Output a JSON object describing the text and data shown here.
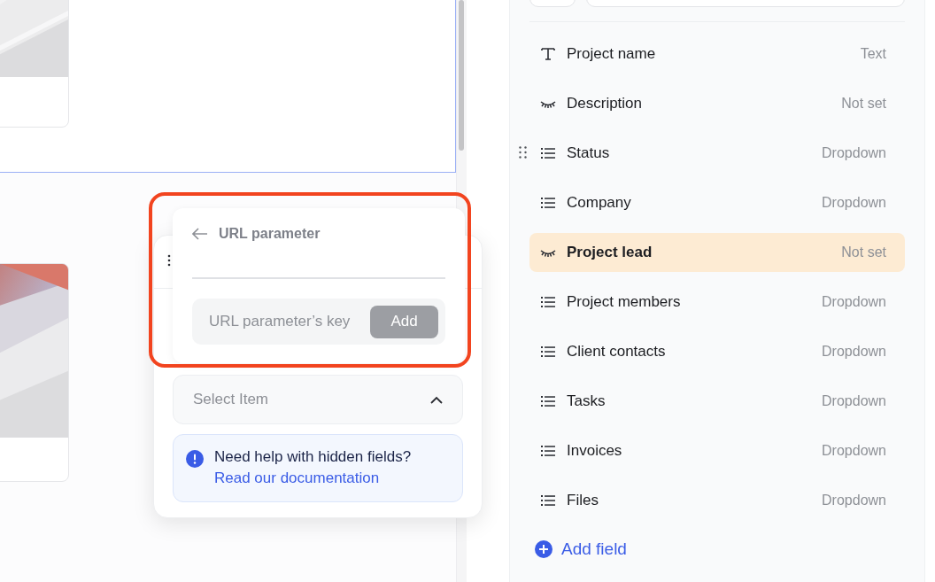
{
  "url_parameter": {
    "title": "URL parameter",
    "key_field": {
      "placeholder": "URL parameter’s key"
    },
    "add_button": {
      "label": "Add",
      "disabled": true
    }
  },
  "popover": {
    "select": {
      "placeholder": "Select Item",
      "expanded": true
    },
    "help": {
      "text": "Need help with hidden fields?",
      "link": "Read our documentation"
    }
  },
  "fields_panel": {
    "fields": [
      {
        "label": "Project name",
        "type": "Text",
        "kind": "text",
        "selected": false,
        "hovered": false
      },
      {
        "label": "Description",
        "type": "Not set",
        "kind": "hidden",
        "selected": false,
        "hovered": false
      },
      {
        "label": "Status",
        "type": "Dropdown",
        "kind": "dropdown",
        "selected": false,
        "hovered": true
      },
      {
        "label": "Company",
        "type": "Dropdown",
        "kind": "dropdown",
        "selected": false,
        "hovered": false
      },
      {
        "label": "Project lead",
        "type": "Not set",
        "kind": "hidden",
        "selected": true,
        "hovered": false
      },
      {
        "label": "Project members",
        "type": "Dropdown",
        "kind": "dropdown",
        "selected": false,
        "hovered": false
      },
      {
        "label": "Client contacts",
        "type": "Dropdown",
        "kind": "dropdown",
        "selected": false,
        "hovered": false
      },
      {
        "label": "Tasks",
        "type": "Dropdown",
        "kind": "dropdown",
        "selected": false,
        "hovered": false
      },
      {
        "label": "Invoices",
        "type": "Dropdown",
        "kind": "dropdown",
        "selected": false,
        "hovered": false
      },
      {
        "label": "Files",
        "type": "Dropdown",
        "kind": "dropdown",
        "selected": false,
        "hovered": false
      }
    ],
    "add_field": "Add field"
  }
}
